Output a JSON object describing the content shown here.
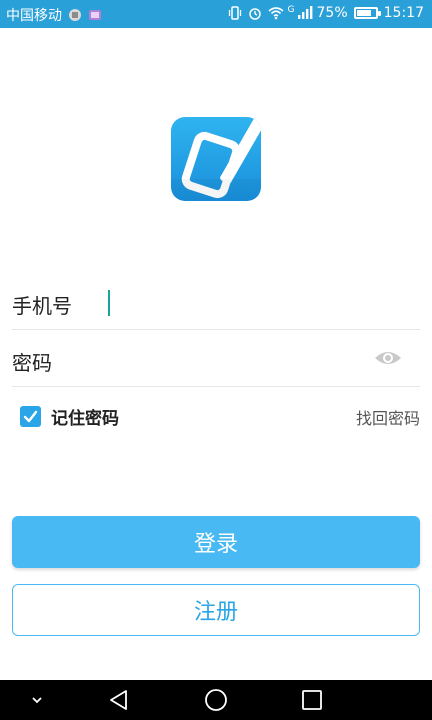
{
  "status_bar": {
    "carrier": "中国移动",
    "signal_type": "G",
    "battery_percent": "75%",
    "battery_level": 0.75,
    "time": "15:17"
  },
  "form": {
    "phone_label": "手机号",
    "password_label": "密码",
    "remember_label": "记住密码",
    "remember_checked": true,
    "forgot_label": "找回密码"
  },
  "buttons": {
    "login": "登录",
    "register": "注册"
  },
  "icons": {
    "app": "app-logo-icon",
    "eye": "eye-icon",
    "nav": [
      "chevron-down-icon",
      "back-triangle-icon",
      "home-circle-icon",
      "recents-square-icon"
    ]
  },
  "colors": {
    "accent": "#48b9f2",
    "status_bar": "#29a0d8",
    "caret": "#1aa39a"
  }
}
